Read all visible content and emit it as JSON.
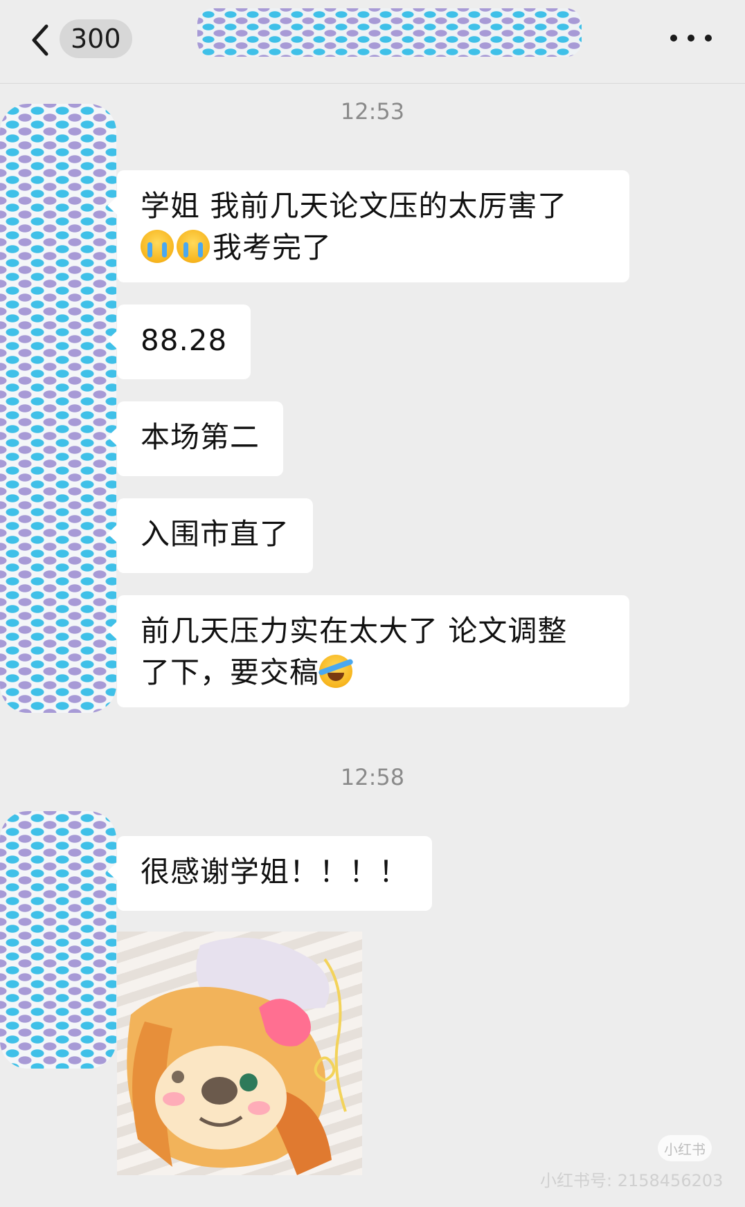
{
  "header": {
    "unread_count": "300"
  },
  "messages": [
    {
      "time": "12:53"
    },
    {
      "lines": [
        "学姐 我前几天论文压的太厉害了",
        "我考完了"
      ],
      "emoji_line2": [
        "loudly-crying-face",
        "loudly-crying-face"
      ]
    },
    {
      "text": "88.28"
    },
    {
      "text": "本场第二"
    },
    {
      "text": "入围市直了"
    },
    {
      "lines": [
        "前几天压力实在太大了 论文调整",
        "了下，要交稿"
      ],
      "emoji_line2_end": [
        "face-with-tears-of-joy"
      ]
    },
    {
      "time": "12:58"
    },
    {
      "text": "很感谢学姐！！！！"
    },
    {
      "image": "plush-bear-sticker"
    }
  ],
  "times": [
    "12:53",
    "12:58"
  ],
  "bubbles": {
    "b1_line1": "学姐 我前几天论文压的太厉害了",
    "b1_line2": "我考完了",
    "b2": "88.28",
    "b3": "本场第二",
    "b4": "入围市直了",
    "b5_line1": "前几天压力实在太大了 论文调整",
    "b5_line2": "了下，要交稿",
    "b6": "很感谢学姐！！！！"
  },
  "watermark": {
    "logo": "小红书",
    "id": "小红书号: 2158456203"
  },
  "colors": {
    "background": "#ededed",
    "bubble": "#ffffff",
    "scribble_blue": "#3fc0e8",
    "scribble_purple": "#a79ad6"
  }
}
